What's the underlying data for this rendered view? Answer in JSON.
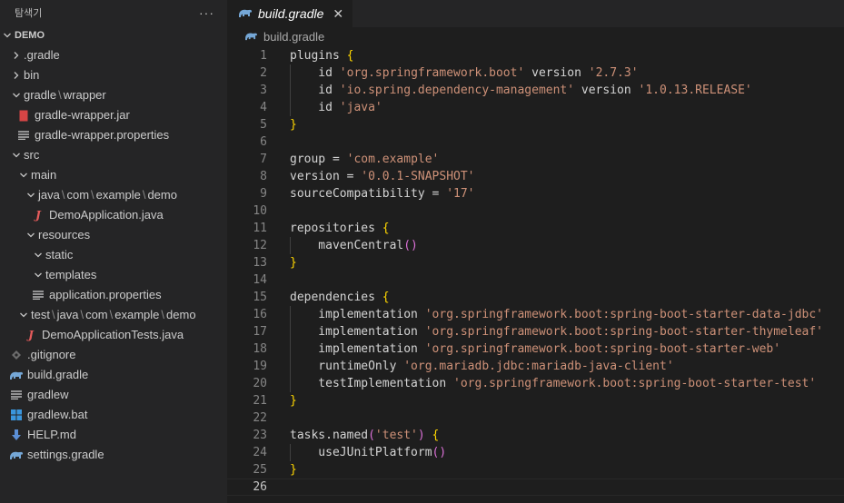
{
  "explorer": {
    "title": "탐색기",
    "more": "···",
    "tree": [
      {
        "name": "tree-root-demo",
        "label": "DEMO",
        "indent": 0,
        "chevron": "down",
        "root": true
      },
      {
        "name": "tree-folder-dot-gradle",
        "label": ".gradle",
        "indent": 1,
        "chevron": "right"
      },
      {
        "name": "tree-folder-bin",
        "label": "bin",
        "indent": 1,
        "chevron": "right"
      },
      {
        "name": "tree-folder-gradle-wrapper",
        "parts": [
          "gradle",
          "wrapper"
        ],
        "indent": 1,
        "chevron": "down"
      },
      {
        "name": "tree-file-gradle-wrapper-jar",
        "label": "gradle-wrapper.jar",
        "indent": 2,
        "icon": "jar"
      },
      {
        "name": "tree-file-gradle-wrapper-properties",
        "label": "gradle-wrapper.properties",
        "indent": 2,
        "icon": "lines"
      },
      {
        "name": "tree-folder-src",
        "label": "src",
        "indent": 1,
        "chevron": "down"
      },
      {
        "name": "tree-folder-main",
        "label": "main",
        "indent": 2,
        "chevron": "down"
      },
      {
        "name": "tree-folder-java-com-example-demo",
        "parts": [
          "java",
          "com",
          "example",
          "demo"
        ],
        "indent": 3,
        "chevron": "down"
      },
      {
        "name": "tree-file-demo-application-java",
        "label": "DemoApplication.java",
        "indent": 4,
        "icon": "java"
      },
      {
        "name": "tree-folder-resources",
        "label": "resources",
        "indent": 3,
        "chevron": "down"
      },
      {
        "name": "tree-folder-static",
        "label": "static",
        "indent": 4,
        "chevron": "down"
      },
      {
        "name": "tree-folder-templates",
        "label": "templates",
        "indent": 4,
        "chevron": "down"
      },
      {
        "name": "tree-file-application-properties",
        "label": "application.properties",
        "indent": 4,
        "icon": "lines"
      },
      {
        "name": "tree-folder-test-java-com-example-demo",
        "parts": [
          "test",
          "java",
          "com",
          "example",
          "demo"
        ],
        "indent": 2,
        "chevron": "down"
      },
      {
        "name": "tree-file-demo-application-tests-java",
        "label": "DemoApplicationTests.java",
        "indent": 3,
        "icon": "java"
      },
      {
        "name": "tree-file-gitignore",
        "label": ".gitignore",
        "indent": 1,
        "icon": "git"
      },
      {
        "name": "tree-file-build-gradle",
        "label": "build.gradle",
        "indent": 1,
        "icon": "gradle"
      },
      {
        "name": "tree-file-gradlew",
        "label": "gradlew",
        "indent": 1,
        "icon": "lines"
      },
      {
        "name": "tree-file-gradlew-bat",
        "label": "gradlew.bat",
        "indent": 1,
        "icon": "win"
      },
      {
        "name": "tree-file-help-md",
        "label": "HELP.md",
        "indent": 1,
        "icon": "md"
      },
      {
        "name": "tree-file-settings-gradle",
        "label": "settings.gradle",
        "indent": 1,
        "icon": "gradle"
      }
    ]
  },
  "editor": {
    "tab_label": "build.gradle",
    "tab_close": "✕",
    "breadcrumb": "build.gradle",
    "current_line": 26,
    "lines": [
      [
        {
          "t": "plugins "
        },
        {
          "t": "{",
          "c": "brace"
        }
      ],
      [
        {
          "t": "    id "
        },
        {
          "t": "'org.springframework.boot'",
          "c": "str"
        },
        {
          "t": " version "
        },
        {
          "t": "'2.7.3'",
          "c": "str"
        }
      ],
      [
        {
          "t": "    id "
        },
        {
          "t": "'io.spring.dependency-management'",
          "c": "str"
        },
        {
          "t": " version "
        },
        {
          "t": "'1.0.13.RELEASE'",
          "c": "str"
        }
      ],
      [
        {
          "t": "    id "
        },
        {
          "t": "'java'",
          "c": "str"
        }
      ],
      [
        {
          "t": "}",
          "c": "brace"
        }
      ],
      [],
      [
        {
          "t": "group = "
        },
        {
          "t": "'com.example'",
          "c": "str"
        }
      ],
      [
        {
          "t": "version = "
        },
        {
          "t": "'0.0.1-SNAPSHOT'",
          "c": "str"
        }
      ],
      [
        {
          "t": "sourceCompatibility = "
        },
        {
          "t": "'17'",
          "c": "str"
        }
      ],
      [],
      [
        {
          "t": "repositories "
        },
        {
          "t": "{",
          "c": "brace"
        }
      ],
      [
        {
          "t": "    mavenCentral"
        },
        {
          "t": "()",
          "c": "paren"
        }
      ],
      [
        {
          "t": "}",
          "c": "brace"
        }
      ],
      [],
      [
        {
          "t": "dependencies "
        },
        {
          "t": "{",
          "c": "brace"
        }
      ],
      [
        {
          "t": "    implementation "
        },
        {
          "t": "'org.springframework.boot:spring-boot-starter-data-jdbc'",
          "c": "str"
        }
      ],
      [
        {
          "t": "    implementation "
        },
        {
          "t": "'org.springframework.boot:spring-boot-starter-thymeleaf'",
          "c": "str"
        }
      ],
      [
        {
          "t": "    implementation "
        },
        {
          "t": "'org.springframework.boot:spring-boot-starter-web'",
          "c": "str"
        }
      ],
      [
        {
          "t": "    runtimeOnly "
        },
        {
          "t": "'org.mariadb.jdbc:mariadb-java-client'",
          "c": "str"
        }
      ],
      [
        {
          "t": "    testImplementation "
        },
        {
          "t": "'org.springframework.boot:spring-boot-starter-test'",
          "c": "str"
        }
      ],
      [
        {
          "t": "}",
          "c": "brace"
        }
      ],
      [],
      [
        {
          "t": "tasks.named"
        },
        {
          "t": "(",
          "c": "paren"
        },
        {
          "t": "'test'",
          "c": "str"
        },
        {
          "t": ")",
          "c": "paren"
        },
        {
          "t": " "
        },
        {
          "t": "{",
          "c": "brace"
        }
      ],
      [
        {
          "t": "    useJUnitPlatform"
        },
        {
          "t": "()",
          "c": "paren"
        }
      ],
      [
        {
          "t": "}",
          "c": "brace"
        }
      ],
      []
    ]
  }
}
